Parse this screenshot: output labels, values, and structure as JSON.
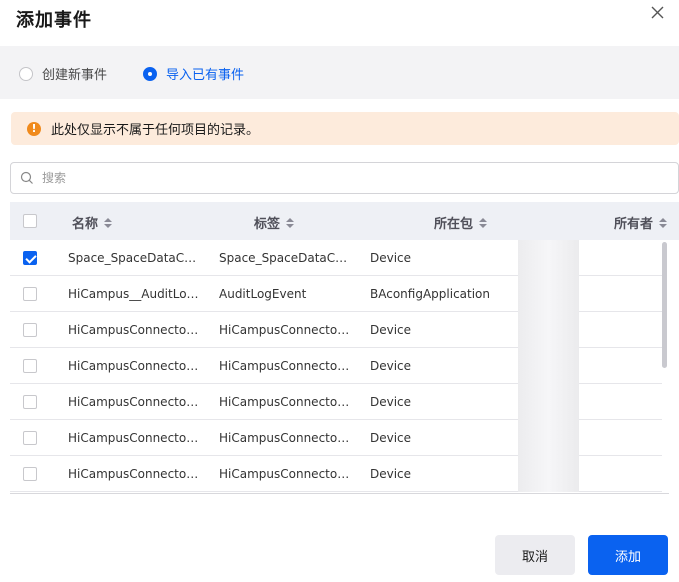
{
  "dialog": {
    "title": "添加事件",
    "close_icon": "close-icon"
  },
  "mode": {
    "options": [
      {
        "label": "创建新事件",
        "selected": false
      },
      {
        "label": "导入已有事件",
        "selected": true
      }
    ]
  },
  "notice": {
    "text": "此处仅显示不属于任何项目的记录。",
    "icon": "warning-icon"
  },
  "search": {
    "placeholder": "搜索",
    "value": "",
    "icon": "search-icon"
  },
  "table": {
    "columns": [
      "名称",
      "标签",
      "所在包",
      "所有者"
    ],
    "rows": [
      {
        "checked": true,
        "name": "Space_SpaceDataCha…",
        "label": "Space_SpaceDataCha…",
        "package": "Device"
      },
      {
        "checked": false,
        "name": "HiCampus__AuditLog…",
        "label": "AuditLogEvent",
        "package": "BAconfigApplication"
      },
      {
        "checked": false,
        "name": "HiCampusConnector…",
        "label": "HiCampusConnector…",
        "package": "Device"
      },
      {
        "checked": false,
        "name": "HiCampusConnector…",
        "label": "HiCampusConnector…",
        "package": "Device"
      },
      {
        "checked": false,
        "name": "HiCampusConnector…",
        "label": "HiCampusConnector…",
        "package": "Device"
      },
      {
        "checked": false,
        "name": "HiCampusConnector…",
        "label": "HiCampusConnector…",
        "package": "Device"
      },
      {
        "checked": false,
        "name": "HiCampusConnector…",
        "label": "HiCampusConnector…",
        "package": "Device"
      }
    ]
  },
  "footer": {
    "cancel_label": "取消",
    "add_label": "添加"
  },
  "colors": {
    "primary": "#0a62f0",
    "notice_bg": "#fdebdc",
    "warning": "#f08a1c"
  }
}
